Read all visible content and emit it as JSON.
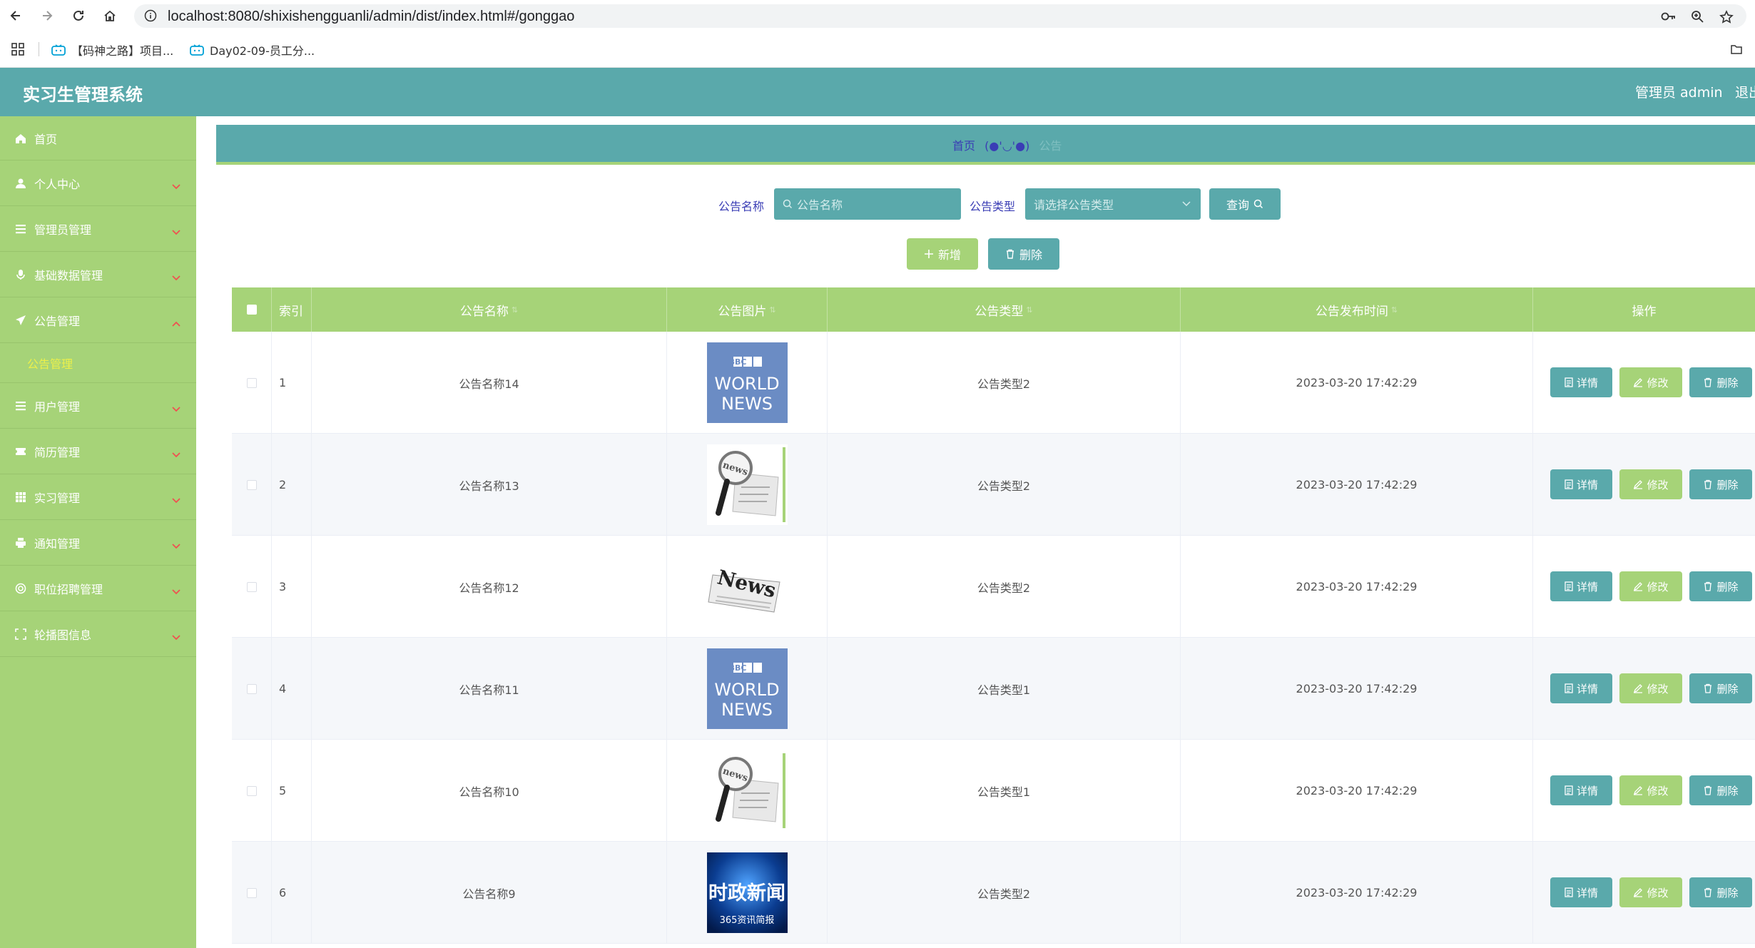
{
  "browser": {
    "url": "localhost:8080/shixishengguanli/admin/dist/index.html#/gonggao",
    "bookmarks": [
      "【码神之路】项目...",
      "Day02-09-员工分..."
    ]
  },
  "header": {
    "title": "实习生管理系统",
    "user": "管理员 admin",
    "logout": "退出"
  },
  "sidebar": {
    "items": [
      {
        "label": "首页",
        "icon": "home-icon"
      },
      {
        "label": "个人中心",
        "icon": "user-icon"
      },
      {
        "label": "管理员管理",
        "icon": "list-icon"
      },
      {
        "label": "基础数据管理",
        "icon": "mic-icon"
      },
      {
        "label": "公告管理",
        "icon": "send-icon",
        "expanded": true
      },
      {
        "label": "用户管理",
        "icon": "list-icon"
      },
      {
        "label": "简历管理",
        "icon": "ticket-icon"
      },
      {
        "label": "实习管理",
        "icon": "grid-icon"
      },
      {
        "label": "通知管理",
        "icon": "printer-icon"
      },
      {
        "label": "职位招聘管理",
        "icon": "circle-icon"
      },
      {
        "label": "轮播图信息",
        "icon": "fullscreen-icon"
      }
    ],
    "submenu": "公告管理"
  },
  "breadcrumb": {
    "home": "首页",
    "separator": "(●'◡'●)",
    "current": "公告"
  },
  "search": {
    "name_label": "公告名称",
    "name_placeholder": "公告名称",
    "type_label": "公告类型",
    "type_placeholder": "请选择公告类型",
    "query_button": "查询"
  },
  "toolbar": {
    "add_button": "新增",
    "delete_button": "删除"
  },
  "table": {
    "columns": [
      "索引",
      "公告名称",
      "公告图片",
      "公告类型",
      "公告发布时间",
      "操作"
    ],
    "actions": {
      "detail": "详情",
      "edit": "修改",
      "delete": "删除"
    },
    "rows": [
      {
        "index": "1",
        "name": "公告名称14",
        "image": "bbc-world-news",
        "type": "公告类型2",
        "time": "2023-03-20 17:42:29"
      },
      {
        "index": "2",
        "name": "公告名称13",
        "image": "magnifier-news",
        "type": "公告类型2",
        "time": "2023-03-20 17:42:29"
      },
      {
        "index": "3",
        "name": "公告名称12",
        "image": "news-paper",
        "type": "公告类型2",
        "time": "2023-03-20 17:42:29"
      },
      {
        "index": "4",
        "name": "公告名称11",
        "image": "bbc-world-news",
        "type": "公告类型1",
        "time": "2023-03-20 17:42:29"
      },
      {
        "index": "5",
        "name": "公告名称10",
        "image": "magnifier-news",
        "type": "公告类型1",
        "time": "2023-03-20 17:42:29"
      },
      {
        "index": "6",
        "name": "公告名称9",
        "image": "shizheng-news",
        "type": "公告类型2",
        "time": "2023-03-20 17:42:29"
      }
    ]
  },
  "thumbnails": {
    "bbc_line1": "BBC",
    "bbc_line2": "WORLD",
    "bbc_line3": "NEWS",
    "magnifier_text": "news",
    "paper_text": "News",
    "shizheng_title": "时政新闻",
    "shizheng_sub": "365资讯简报"
  },
  "colors": {
    "teal": "#5aa9ab",
    "green": "#a6d378",
    "submenu_active": "#ecf04a",
    "breadcrumb_link": "#3a3db5"
  }
}
